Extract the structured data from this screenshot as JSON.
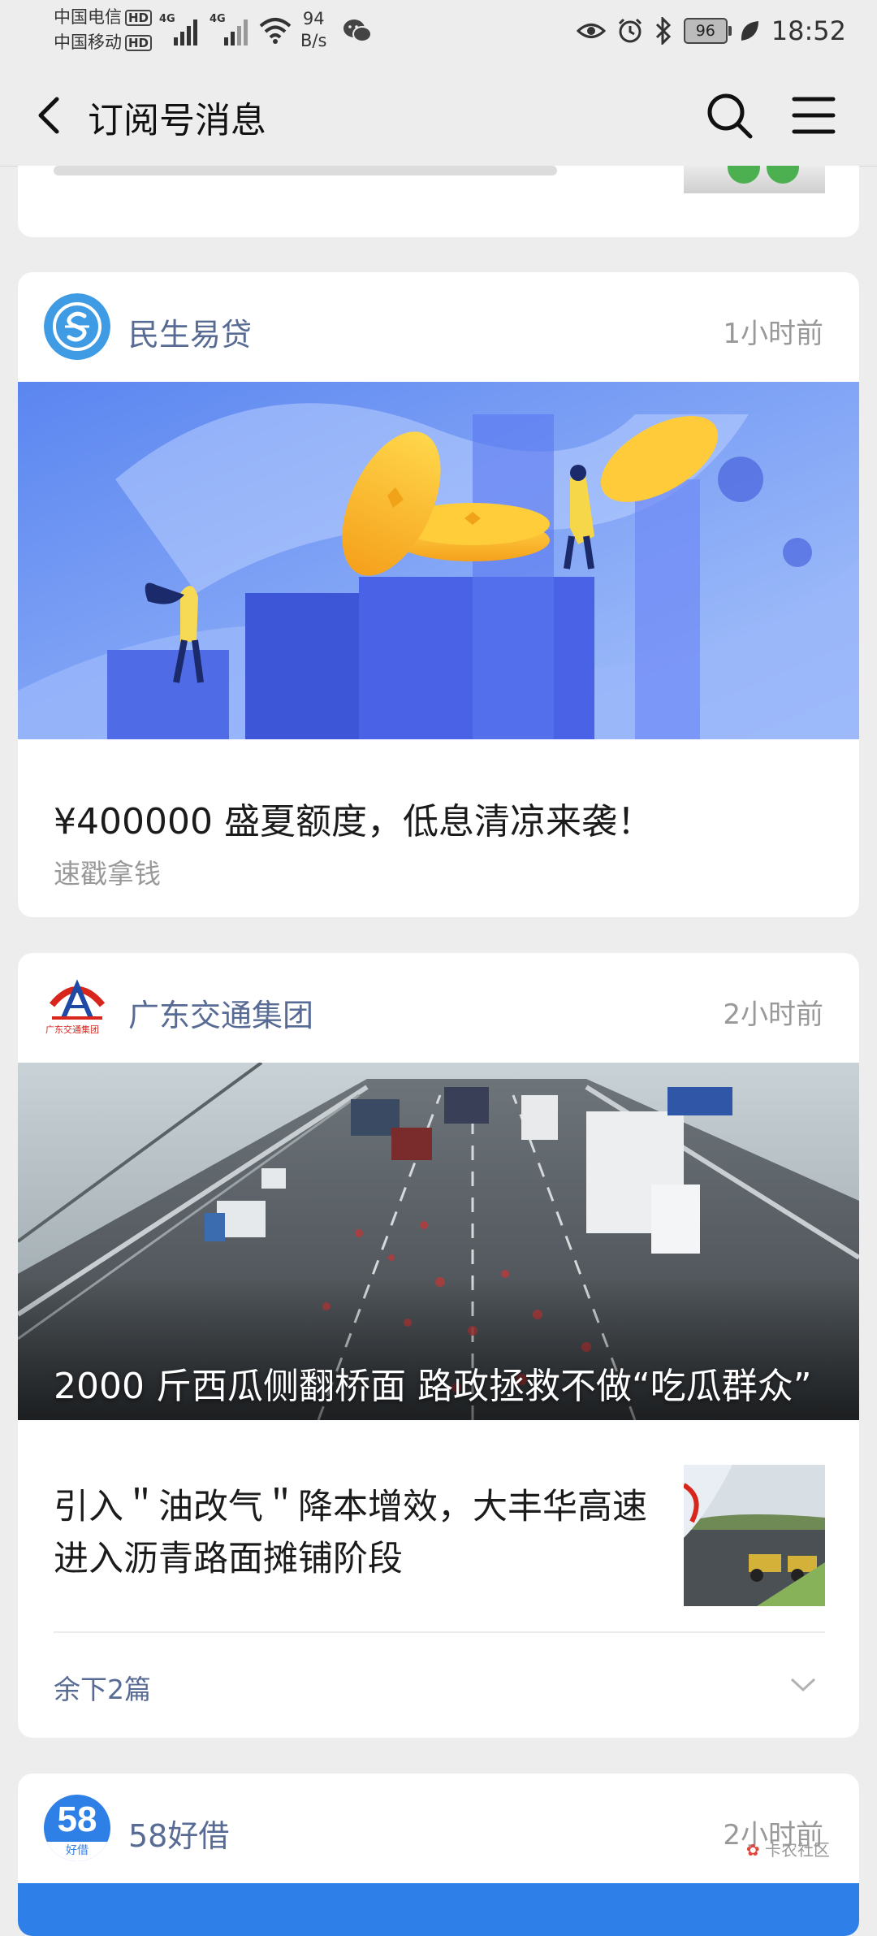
{
  "status_bar": {
    "carrier_1": "中国电信",
    "carrier_2": "中国移动",
    "hd": "HD",
    "network_1": "4G",
    "network_2": "4G",
    "speed_value": "94",
    "speed_unit": "B/s",
    "battery": "96",
    "time": "18:52"
  },
  "nav": {
    "title": "订阅号消息"
  },
  "cards": [
    {
      "source": "民生易贷",
      "time": "1小时前",
      "title": "¥400000 盛夏额度，低息清凉来袭！",
      "subtitle": "速戳拿钱"
    },
    {
      "source": "广东交通集团",
      "time": "2小时前",
      "logo_text": "广东交通集团",
      "hero_title": "2000 斤西瓜侧翻桥面 路政拯救不做“吃瓜群众”",
      "article_title": "引入＂油改气＂降本增效，大丰华高速进入沥青路面摊铺阶段",
      "more": "余下2篇"
    },
    {
      "source": "58好借",
      "time": "2小时前",
      "logo_text": "58",
      "logo_sub": "好借"
    }
  ],
  "watermark": "卡农社区"
}
